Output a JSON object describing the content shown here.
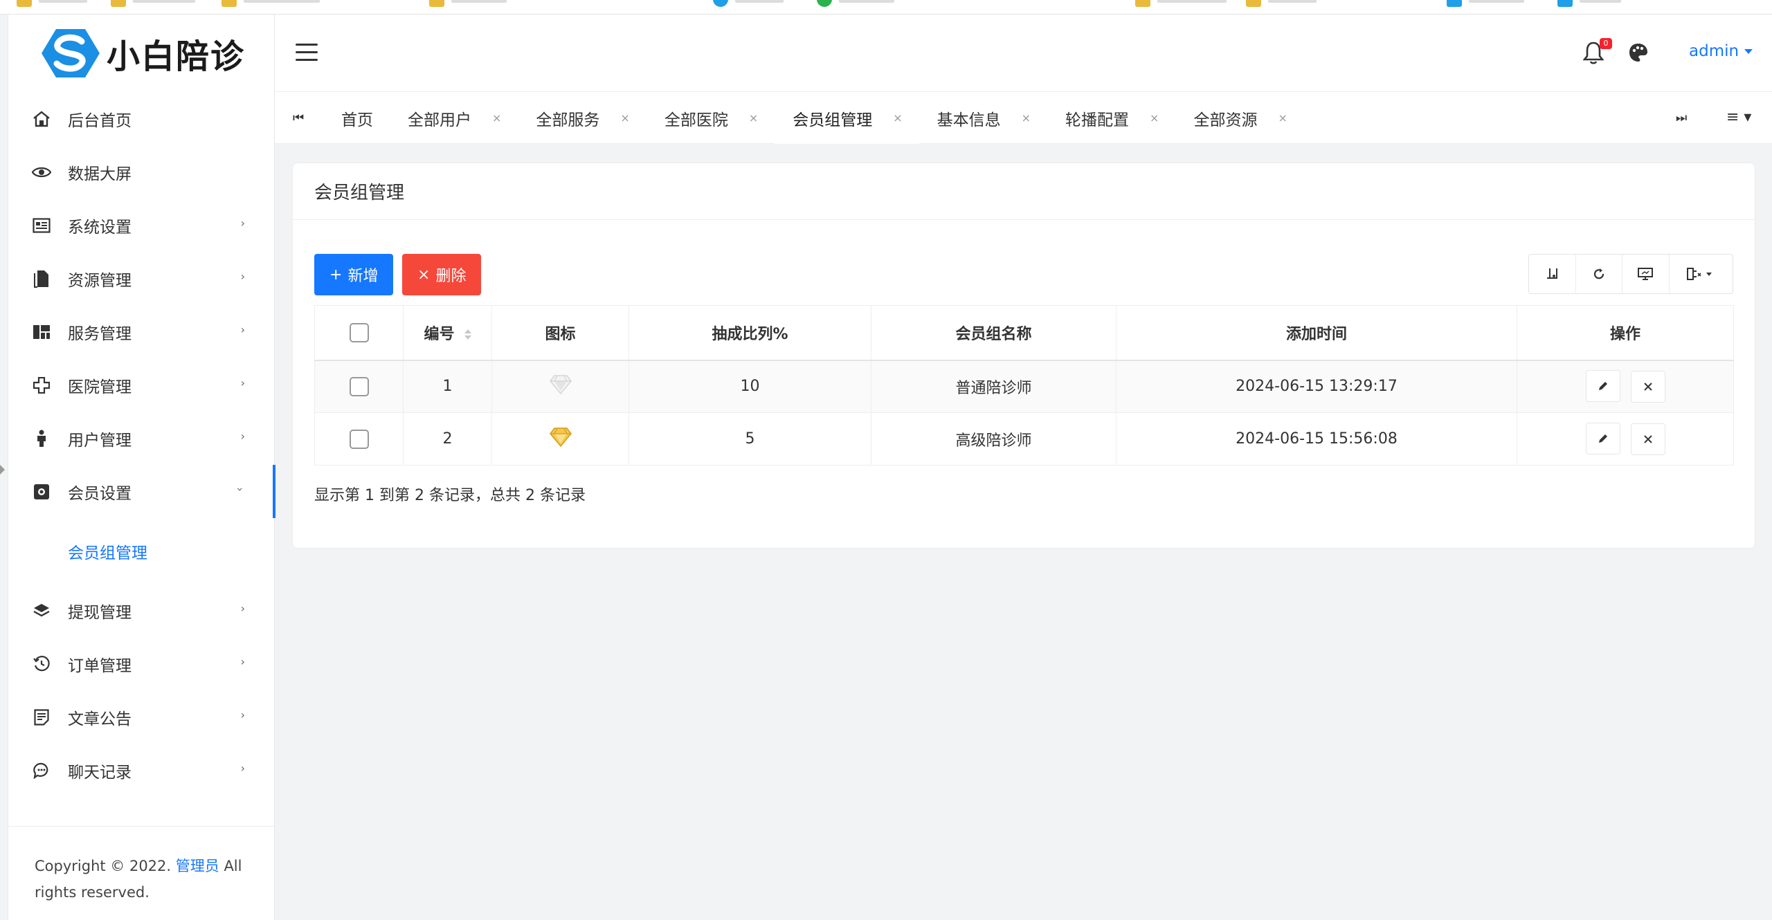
{
  "app": {
    "logo_text": "小白陪诊",
    "brand_color": "#1677ff"
  },
  "sidebar": {
    "items": [
      {
        "label": "后台首页",
        "icon": "home-icon",
        "has_children": false
      },
      {
        "label": "数据大屏",
        "icon": "eye-icon",
        "has_children": false
      },
      {
        "label": "系统设置",
        "icon": "system-settings-icon",
        "has_children": true
      },
      {
        "label": "资源管理",
        "icon": "file-icon",
        "has_children": true
      },
      {
        "label": "服务管理",
        "icon": "grid-icon",
        "has_children": true
      },
      {
        "label": "医院管理",
        "icon": "plus-cross-icon",
        "has_children": true
      },
      {
        "label": "用户管理",
        "icon": "person-icon",
        "has_children": true
      },
      {
        "label": "会员设置",
        "icon": "member-icon",
        "has_children": true,
        "expanded": true
      }
    ],
    "subitem": {
      "label": "会员组管理"
    },
    "items_after": [
      {
        "label": "提现管理",
        "icon": "layers-icon",
        "has_children": true
      },
      {
        "label": "订单管理",
        "icon": "history-icon",
        "has_children": true
      },
      {
        "label": "文章公告",
        "icon": "article-icon",
        "has_children": true
      },
      {
        "label": "聊天记录",
        "icon": "chat-icon",
        "has_children": true
      }
    ],
    "footer": {
      "prefix": "Copyright © 2022. ",
      "link": "管理员",
      "suffix": " All rights reserved."
    }
  },
  "header": {
    "notification_count": "0",
    "user_name": "admin"
  },
  "tabs": {
    "items": [
      {
        "label": "首页",
        "closable": false
      },
      {
        "label": "全部用户",
        "closable": true
      },
      {
        "label": "全部服务",
        "closable": true
      },
      {
        "label": "全部医院",
        "closable": true
      },
      {
        "label": "会员组管理",
        "closable": true,
        "active": true
      },
      {
        "label": "基本信息",
        "closable": true
      },
      {
        "label": "轮播配置",
        "closable": true
      },
      {
        "label": "全部资源",
        "closable": true
      }
    ],
    "close_glyph": "×"
  },
  "card": {
    "title": "会员组管理",
    "add_label": "新增",
    "delete_label": "删除",
    "add_icon": "+",
    "delete_icon": "×"
  },
  "table": {
    "columns": [
      "编号",
      "图标",
      "抽成比列%",
      "会员组名称",
      "添加时间",
      "操作"
    ],
    "rows": [
      {
        "id": "1",
        "icon": "silver-diamond-icon",
        "rate": "10",
        "name": "普通陪诊师",
        "time": "2024-06-15 13:29:17"
      },
      {
        "id": "2",
        "icon": "gold-diamond-icon",
        "rate": "5",
        "name": "高级陪诊师",
        "time": "2024-06-15 15:56:08"
      }
    ]
  },
  "pagination": {
    "summary": "显示第 1 到第 2 条记录，总共 2 条记录"
  }
}
